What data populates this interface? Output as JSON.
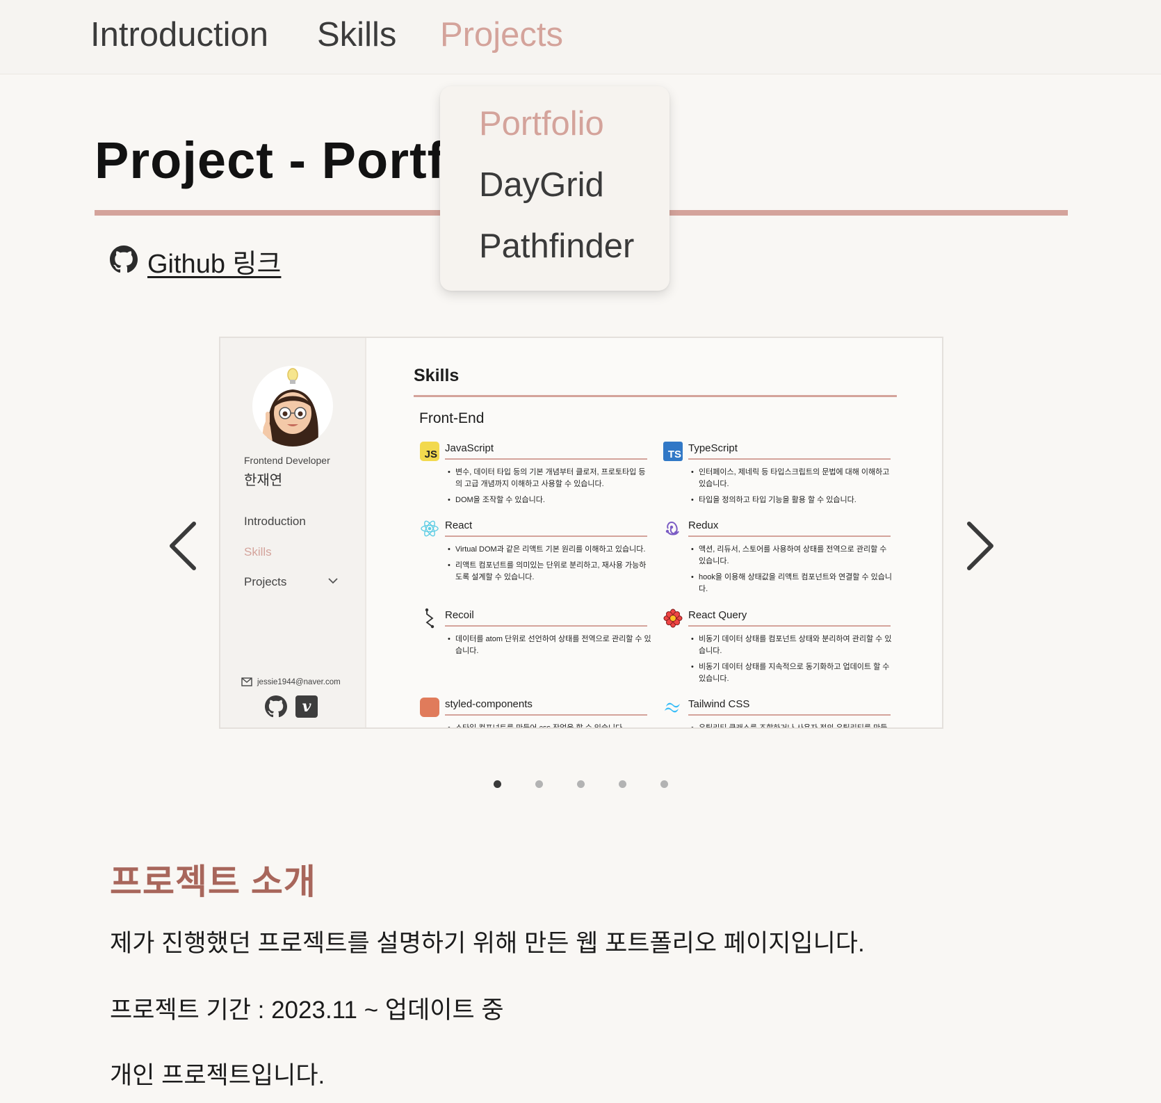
{
  "nav": {
    "items": [
      {
        "label": "Introduction"
      },
      {
        "label": "Skills"
      },
      {
        "label": "Projects",
        "active": true
      }
    ],
    "dropdown": [
      "Portfolio",
      "DayGrid",
      "Pathfinder"
    ]
  },
  "page": {
    "title": "Project - Portfolio",
    "github_label": "Github 링크"
  },
  "carousel": {
    "slide_count": 5,
    "active_index": 0,
    "slide": {
      "sidebar": {
        "role": "Frontend Developer",
        "name": "한재연",
        "items": [
          "Introduction",
          "Skills",
          "Projects"
        ],
        "active_item": "Skills",
        "email": "jessie1944@naver.com",
        "social_v": "v"
      },
      "main": {
        "title": "Skills",
        "section": "Front-End",
        "skills": {
          "js": {
            "name": "JavaScript",
            "badge": "JS",
            "bullets": [
              "변수, 데이터 타입 등의 기본 개념부터 클로저, 프로토타입 등의 고급 개념까지 이해하고 사용할 수 있습니다.",
              "DOM을 조작할 수 있습니다."
            ]
          },
          "ts": {
            "name": "TypeScript",
            "badge": "TS",
            "bullets": [
              "인터페이스, 제네릭 등 타입스크립트의 문법에 대해 이해하고 있습니다.",
              "타입을 정의하고 타입 기능을 활용 할 수 있습니다."
            ]
          },
          "react": {
            "name": "React",
            "bullets": [
              "Virtual DOM과 같은 리액트 기본 원리를 이해하고 있습니다.",
              "리액트 컴포넌트를 의미있는 단위로 분리하고, 재사용 가능하도록 설계할 수 있습니다."
            ]
          },
          "redux": {
            "name": "Redux",
            "bullets": [
              "액션, 리듀서, 스토어를 사용하여 상태를 전역으로 관리할 수 있습니다.",
              "hook을 이용해 상태값을 리액트 컴포넌트와 연결할 수 있습니다."
            ]
          },
          "recoil": {
            "name": "Recoil",
            "bullets": [
              "데이터를 atom 단위로 선언하여 상태를 전역으로 관리할 수 있습니다."
            ]
          },
          "rq": {
            "name": "React Query",
            "bullets": [
              "비동기 데이터 상태를 컴포넌트 상태와 분리하여 관리할 수 있습니다.",
              "비동기 데이터 상태를 지속적으로 동기화하고 업데이트 할 수 있습니다."
            ]
          },
          "sc": {
            "name": "styled-components",
            "bullets": [
              "스타일 컴포넌트를 만들어 css 작업을 할 수 있습니다."
            ]
          },
          "tw": {
            "name": "Tailwind CSS",
            "bullets": [
              "유틸리티 클래스를 조합하거나 사용자 정의 유틸리티를 만들"
            ]
          }
        }
      }
    }
  },
  "intro": {
    "heading": "프로젝트 소개",
    "paragraphs": [
      "제가 진행했던 프로젝트를 설명하기 위해 만든 웹 포트폴리오 페이지입니다.",
      "프로젝트 기간 : 2023.11 ~ 업데이트 중",
      "개인 프로젝트입니다."
    ]
  },
  "colors": {
    "accent": "#d4a39b",
    "heading": "#a8665b",
    "background": "#f9f7f4"
  },
  "icons": [
    "github-icon",
    "chevron-left-icon",
    "chevron-right-icon",
    "mail-icon",
    "react-icon",
    "redux-icon",
    "recoil-icon",
    "react-query-icon",
    "tailwind-icon"
  ]
}
